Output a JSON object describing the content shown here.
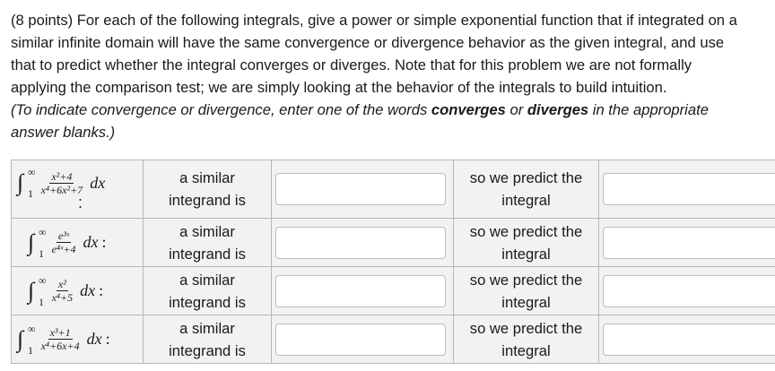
{
  "intro": {
    "line1": "(8 points) For each of the following integrals, give a power or simple exponential function that if integrated on a",
    "line2": "similar infinite domain will have the same convergence or divergence behavior as the given integral, and use",
    "line3": "that to predict whether the integral converges or diverges. Note that for this problem we are not formally",
    "line4": "applying the comparison test; we are simply looking at the behavior of the integrals to build intuition.",
    "line5_pre": "(To indicate convergence or divergence, enter one of the words ",
    "word_converges": "converges",
    "line5_mid": " or ",
    "word_diverges": "diverges",
    "line5_post": " in the appropriate",
    "line6": "answer blanks.)"
  },
  "labels": {
    "similar_a": "a similar",
    "similar_b": "integrand is",
    "predict_a": "so we predict the",
    "predict_b": "integral"
  },
  "rows": [
    {
      "upper": "∞",
      "lower": "1",
      "num": "x²+4",
      "den": "x⁴+6x²+7",
      "dx": "dx",
      "colon": ":",
      "similar_value": "",
      "predict_value": ""
    },
    {
      "upper": "∞",
      "lower": "1",
      "num": "e³ˣ",
      "den": "e⁴ˣ+4",
      "dx": "dx",
      "colon": ":",
      "similar_value": "",
      "predict_value": ""
    },
    {
      "upper": "∞",
      "lower": "1",
      "num": "x²",
      "den": "x⁴+5",
      "dx": "dx",
      "colon": ":",
      "similar_value": "",
      "predict_value": ""
    },
    {
      "upper": "∞",
      "lower": "1",
      "num": "x³+1",
      "den": "x⁴+6x+4",
      "dx": "dx",
      "colon": ":",
      "similar_value": "",
      "predict_value": ""
    }
  ]
}
